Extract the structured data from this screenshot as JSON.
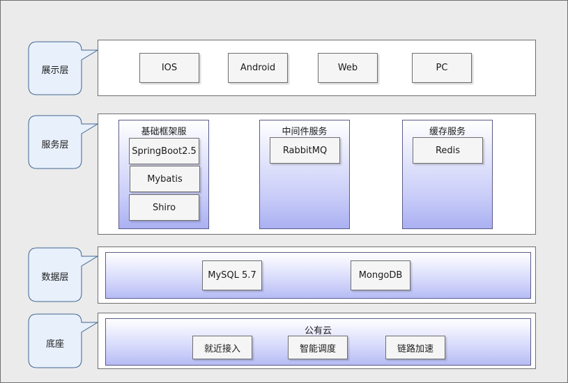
{
  "layers": {
    "presentation": {
      "label": "展示层",
      "clients": [
        "IOS",
        "Android",
        "Web",
        "PC"
      ]
    },
    "service": {
      "label": "服务层",
      "columns": [
        {
          "title": "基础框架服",
          "items": [
            "SpringBoot2.5",
            "Mybatis",
            "Shiro"
          ]
        },
        {
          "title": "中间件服务",
          "items": [
            "RabbitMQ"
          ]
        },
        {
          "title": "缓存服务",
          "items": [
            "Redis"
          ]
        }
      ]
    },
    "data": {
      "label": "数据层",
      "stores": [
        "MySQL 5.7",
        "MongoDB"
      ]
    },
    "base": {
      "label": "底座",
      "cloud_title": "公有云",
      "capabilities": [
        "就近接入",
        "智能调度",
        "链路加速"
      ]
    }
  },
  "colors": {
    "background": "#ebebeb",
    "callout_fill": "#e8f0fb",
    "gradient_end": "#aab0f2",
    "border": "#6e6e6e"
  }
}
